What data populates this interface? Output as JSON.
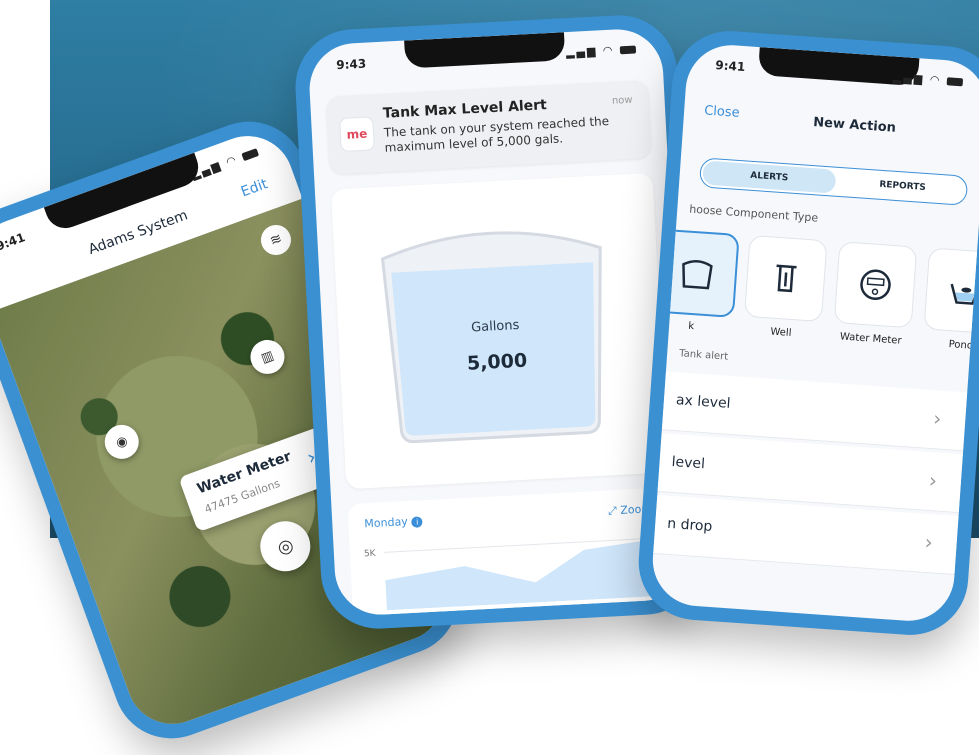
{
  "left_phone": {
    "status_time": "9:41",
    "title": "Adams System",
    "edit_label": "Edit",
    "meter_card": {
      "title": "Water Meter",
      "subtitle": "47475 Gallons"
    }
  },
  "middle_phone": {
    "status_time": "9:43",
    "notification": {
      "app_icon_text": "me",
      "title": "Tank Max Level Alert",
      "body": "The tank on your system reached the maximum level of 5,000 gals.",
      "time": "now"
    },
    "tank": {
      "label": "Gallons",
      "value": "5,000",
      "fill_percent": 90
    },
    "chart": {
      "day_label": "Monday",
      "zoom_label": "Zoom",
      "tick_label": "5K"
    }
  },
  "right_phone": {
    "status_time": "9:41",
    "close_label": "Close",
    "title": "New Action",
    "tabs": {
      "alerts": "ALERTS",
      "reports": "REPORTS"
    },
    "choose_label": "hoose Component Type",
    "components": [
      {
        "label": "k",
        "icon": "tank-icon"
      },
      {
        "label": "Well",
        "icon": "well-icon"
      },
      {
        "label": "Water Meter",
        "icon": "meter-icon"
      },
      {
        "label": "Ponc",
        "icon": "pond-icon"
      }
    ],
    "tank_alert_label": "Tank alert",
    "rows": [
      "ax level",
      "level",
      "n drop"
    ]
  },
  "colors": {
    "accent": "#3b8fd8",
    "phone_frame": "#3a90d1",
    "tank_water": "#cfe6fb",
    "background": "#256a8d"
  }
}
